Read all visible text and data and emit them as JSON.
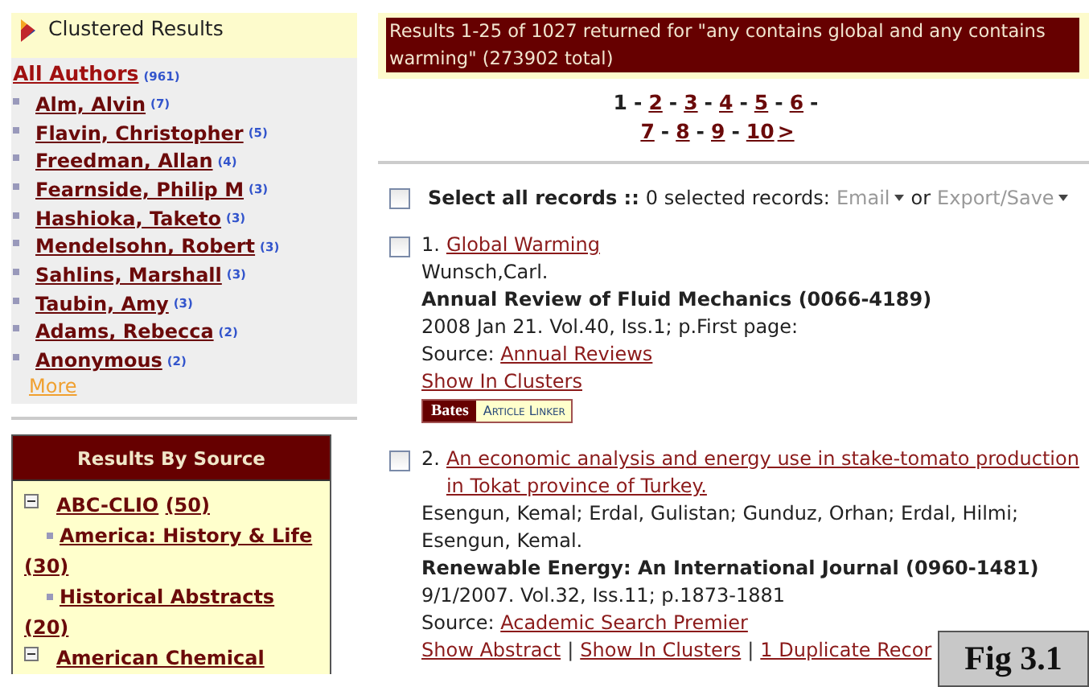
{
  "clusters": {
    "title": "Clustered Results",
    "heading": {
      "label": "All Authors",
      "count": "(961)"
    },
    "authors": [
      {
        "name": "Alm, Alvin",
        "count": "(7)"
      },
      {
        "name": "Flavin, Christopher",
        "count": "(5)"
      },
      {
        "name": "Freedman, Allan",
        "count": "(4)"
      },
      {
        "name": "Fearnside, Philip M",
        "count": "(3)"
      },
      {
        "name": "Hashioka, Taketo",
        "count": "(3)"
      },
      {
        "name": "Mendelsohn, Robert",
        "count": "(3)"
      },
      {
        "name": "Sahlins, Marshall",
        "count": "(3)"
      },
      {
        "name": "Taubin, Amy",
        "count": "(3)"
      },
      {
        "name": "Adams, Rebecca",
        "count": "(2)"
      },
      {
        "name": "Anonymous",
        "count": "(2)"
      }
    ],
    "more": "More"
  },
  "sources": {
    "title": "Results By Source",
    "groups": [
      {
        "label": "ABC-CLIO",
        "count": "(50)",
        "expanded": true,
        "children": [
          {
            "label": "America: History & Life",
            "count": "(30)"
          },
          {
            "label": "Historical Abstracts",
            "count": "(20)"
          }
        ]
      },
      {
        "label": "American Chemical",
        "expanded": true
      }
    ]
  },
  "summary": "Results 1-25 of 1027 returned for \"any contains global and any contains warming\" (273902 total)",
  "pagination": {
    "separator": "-",
    "pages": [
      {
        "label": "1",
        "selected": true
      },
      {
        "label": "2",
        "selected": false
      },
      {
        "label": "3",
        "selected": false
      },
      {
        "label": "4",
        "selected": false
      },
      {
        "label": "5",
        "selected": false
      },
      {
        "label": "6",
        "selected": false
      },
      {
        "label": "7",
        "selected": false
      },
      {
        "label": "8",
        "selected": false
      },
      {
        "label": "9",
        "selected": false
      },
      {
        "label": "10",
        "selected": false
      }
    ],
    "next": ">"
  },
  "select_all": {
    "checked": false,
    "label": "Select all records ::",
    "count": "0 selected records:",
    "email": "Email",
    "or": "or",
    "export": "Export/Save"
  },
  "records": [
    {
      "number": "1.",
      "title": "Global Warming",
      "checked": false,
      "authors": "Wunsch,Carl.",
      "journal": "Annual Review of Fluid Mechanics (0066-4189)",
      "citation": "2008 Jan 21. Vol.40, Iss.1; p.First page:",
      "source_label": "Source:",
      "source": "Annual Reviews",
      "links": [
        "Show In Clusters"
      ],
      "linker": {
        "brand": "Bates",
        "label": "Article Linker"
      }
    },
    {
      "number": "2.",
      "title": "An economic analysis and energy use in stake-tomato production in Tokat province of Turkey.",
      "checked": false,
      "authors": "Esengun, Kemal; Erdal, Gulistan; Gunduz, Orhan; Erdal, Hilmi; Esengun, Kemal.",
      "journal": "Renewable Energy: An International Journal (0960-1481)",
      "citation": "9/1/2007. Vol.32, Iss.11; p.1873-1881",
      "source_label": "Source:",
      "source": "Academic Search Premier",
      "links": [
        "Show Abstract",
        "Show In Clusters",
        "1 Duplicate Recor"
      ],
      "link_separator": "|"
    }
  ],
  "figure_label": "Fig 3.1"
}
